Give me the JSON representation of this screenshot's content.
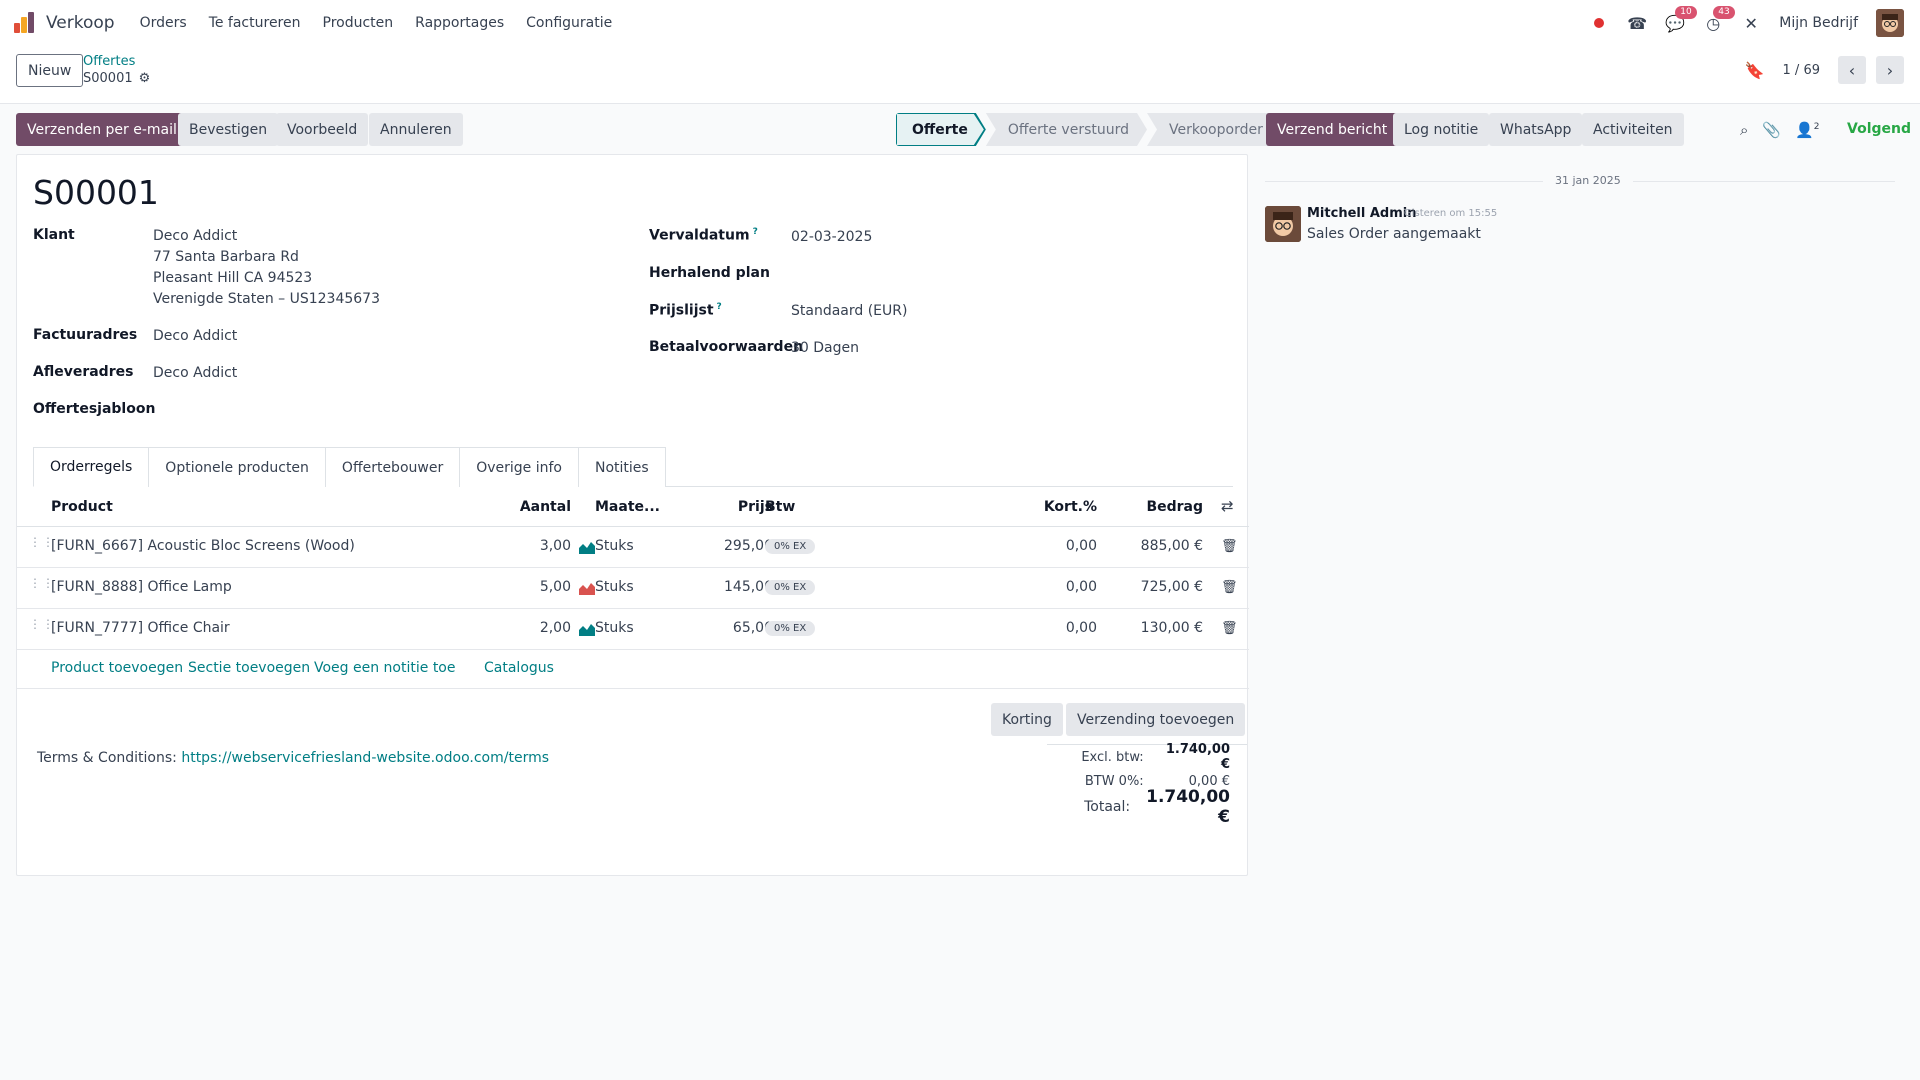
{
  "app": {
    "name": "Verkoop"
  },
  "menu": [
    "Orders",
    "Te factureren",
    "Producten",
    "Rapportages",
    "Configuratie"
  ],
  "topbar": {
    "chat_count": "10",
    "activity_count": "43",
    "company": "Mijn Bedrijf"
  },
  "control": {
    "new_label": "Nieuw",
    "breadcrumb_parent": "Offertes",
    "breadcrumb_current": "S00001",
    "pager": "1 / 69"
  },
  "actions": {
    "send_email": "Verzenden per e-mail",
    "confirm": "Bevestigen",
    "preview": "Voorbeeld",
    "cancel": "Annuleren"
  },
  "status_stages": [
    "Offerte",
    "Offerte verstuurd",
    "Verkooporder"
  ],
  "chatter_actions": {
    "send_message": "Verzend bericht",
    "log_note": "Log notitie",
    "whatsapp": "WhatsApp",
    "activities": "Activiteiten",
    "followers_count": "2",
    "follow": "Volgend"
  },
  "order": {
    "name": "S00001",
    "customer_label": "Klant",
    "customer_lines": [
      "Deco Addict",
      "77 Santa Barbara Rd",
      "Pleasant Hill CA 94523",
      "Verenigde Staten – US12345673"
    ],
    "invoice_address_label": "Factuuradres",
    "invoice_address": "Deco Addict",
    "delivery_address_label": "Afleveradres",
    "delivery_address": "Deco Addict",
    "template_label": "Offertesjabloon",
    "expiry_label": "Vervaldatum",
    "expiry": "02-03-2025",
    "recurring_label": "Herhalend plan",
    "pricelist_label": "Prijslijst",
    "pricelist": "Standaard (EUR)",
    "payment_terms_label": "Betaalvoorwaarden",
    "payment_terms": "30 Dagen"
  },
  "tabs": [
    "Orderregels",
    "Optionele producten",
    "Offertebouwer",
    "Overige info",
    "Notities"
  ],
  "table": {
    "headers": {
      "product": "Product",
      "qty": "Aantal",
      "uom": "Maate...",
      "price": "Prijs",
      "tax": "Btw",
      "discount": "Kort.%",
      "amount": "Bedrag"
    },
    "rows": [
      {
        "product": "[FURN_6667] Acoustic Bloc Screens (Wood)",
        "qty": "3,00",
        "forecast": "ok",
        "uom": "Stuks",
        "price": "295,00",
        "tax": "0% EX",
        "discount": "0,00",
        "amount": "885,00 €"
      },
      {
        "product": "[FURN_8888] Office Lamp",
        "qty": "5,00",
        "forecast": "warning",
        "uom": "Stuks",
        "price": "145,00",
        "tax": "0% EX",
        "discount": "0,00",
        "amount": "725,00 €"
      },
      {
        "product": "[FURN_7777] Office Chair",
        "qty": "2,00",
        "forecast": "ok",
        "uom": "Stuks",
        "price": "65,00",
        "tax": "0% EX",
        "discount": "0,00",
        "amount": "130,00 €"
      }
    ],
    "add_links": {
      "product": "Product toevoegen",
      "section": "Sectie toevoegen",
      "note": "Voeg een notitie toe",
      "catalog": "Catalogus"
    }
  },
  "summary_buttons": {
    "discount": "Korting",
    "shipping": "Verzending toevoegen"
  },
  "terms": {
    "label": "Terms & Conditions:",
    "url": "https://webservicefriesland-website.odoo.com/terms"
  },
  "totals": {
    "untaxed_label": "Excl. btw:",
    "untaxed": "1.740,00 €",
    "tax_label": "BTW 0%:",
    "tax": "0,00 €",
    "total_label": "Totaal:",
    "total": "1.740,00 €"
  },
  "chatter": {
    "date": "31 jan 2025",
    "author": "Mitchell Admin",
    "time": "Gisteren om 15:55",
    "body": "Sales Order aangemaakt"
  },
  "colors": {
    "brand": "#714b67",
    "link": "#017e84",
    "follow": "#28a745",
    "badge": "#d9536f"
  }
}
